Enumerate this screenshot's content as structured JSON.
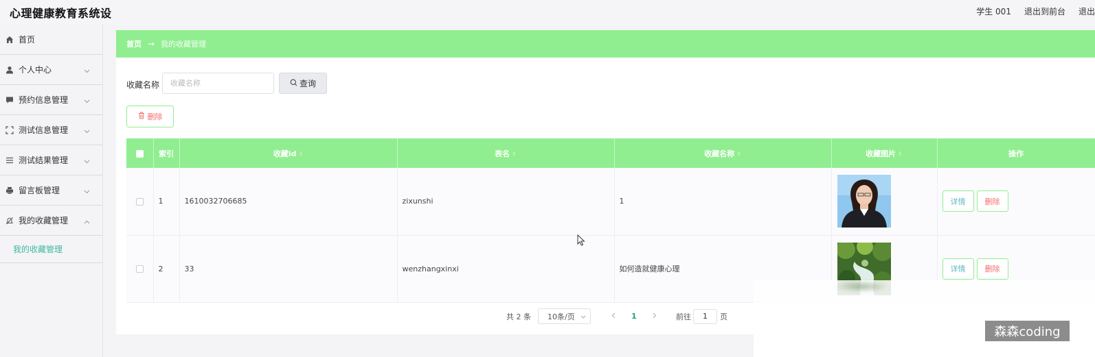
{
  "app": {
    "title": "心理健康教育系统设"
  },
  "header": {
    "user": "学生 001",
    "links": [
      "退出到前台",
      "退出"
    ]
  },
  "sidebar": {
    "items": [
      {
        "label": "首页",
        "icon": "home-icon",
        "expandable": false
      },
      {
        "label": "个人中心",
        "icon": "user-icon",
        "expandable": true
      },
      {
        "label": "预约信息管理",
        "icon": "chat-icon",
        "expandable": true
      },
      {
        "label": "测试信息管理",
        "icon": "fullscreen-icon",
        "expandable": true
      },
      {
        "label": "测试结果管理",
        "icon": "list-icon",
        "expandable": true
      },
      {
        "label": "留言板管理",
        "icon": "printer-icon",
        "expandable": true
      },
      {
        "label": "我的收藏管理",
        "icon": "bell-icon",
        "expandable": true,
        "expanded": true
      }
    ],
    "submenu": {
      "label": "我的收藏管理"
    }
  },
  "breadcrumb": {
    "home": "首页",
    "separator": "→",
    "current": "我的收藏管理"
  },
  "search": {
    "label": "收藏名称",
    "placeholder": "收藏名称",
    "value": "",
    "button_label": "查询"
  },
  "toolbar": {
    "delete_label": "删除"
  },
  "table": {
    "columns": [
      "",
      "索引",
      "收藏id",
      "表名",
      "收藏名称",
      "收藏图片",
      "操作"
    ],
    "rows": [
      {
        "index": "1",
        "id": "1610032706685",
        "table_name": "zixunshi",
        "name": "1",
        "image": "portrait-photo"
      },
      {
        "index": "2",
        "id": "33",
        "table_name": "wenzhangxinxi",
        "name": "如何造就健康心理",
        "image": "forest-stream-photo"
      }
    ],
    "row_actions": {
      "detail": "详情",
      "delete": "删除"
    }
  },
  "pagination": {
    "total": "共 2 条",
    "page_size": "10条/页",
    "current_page": "1",
    "goto_label": "前往",
    "goto_value": "1",
    "page_unit": "页"
  },
  "watermark": "森森coding",
  "colors": {
    "accent_green": "#90ee90",
    "delete_red": "#f56c6c",
    "detail_teal": "#5fb7c4",
    "active_menu": "#3fb8a1"
  }
}
